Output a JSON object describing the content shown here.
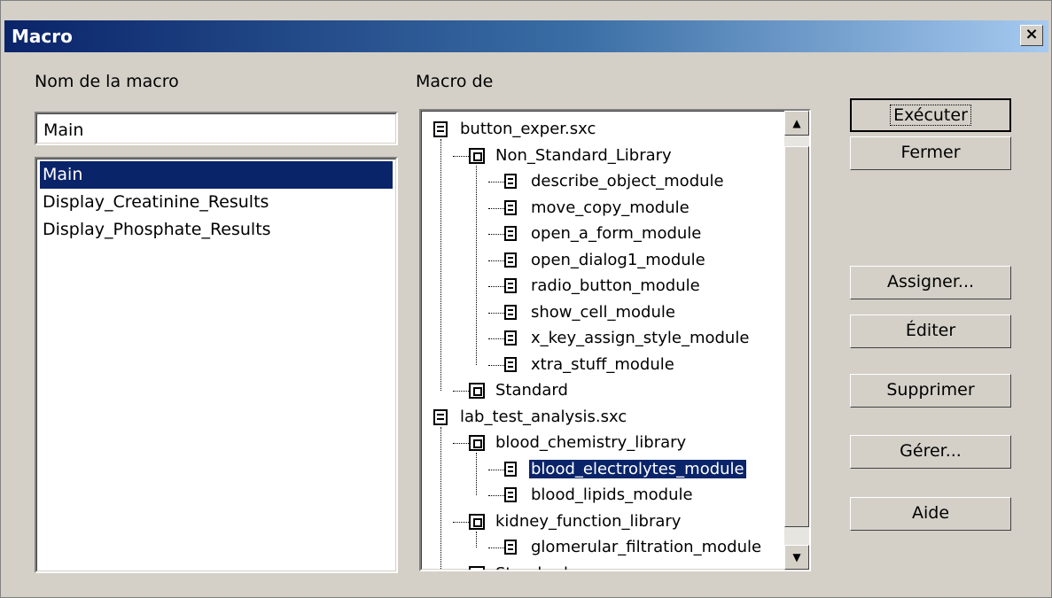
{
  "window": {
    "title": "Macro",
    "close_glyph": "×"
  },
  "left": {
    "name_label": "Nom de la macro",
    "name_value": "Main",
    "macros": [
      {
        "label": "Main",
        "selected": true
      },
      {
        "label": "Display_Creatinine_Results",
        "selected": false
      },
      {
        "label": "Display_Phosphate_Results",
        "selected": false
      }
    ]
  },
  "tree": {
    "label": "Macro de",
    "nodes": [
      {
        "label": "button_exper.sxc",
        "type": "document",
        "level": 0
      },
      {
        "label": "Non_Standard_Library",
        "type": "library",
        "level": 1
      },
      {
        "label": "describe_object_module",
        "type": "module",
        "level": 2
      },
      {
        "label": "move_copy_module",
        "type": "module",
        "level": 2
      },
      {
        "label": "open_a_form_module",
        "type": "module",
        "level": 2
      },
      {
        "label": "open_dialog1_module",
        "type": "module",
        "level": 2
      },
      {
        "label": "radio_button_module",
        "type": "module",
        "level": 2
      },
      {
        "label": "show_cell_module",
        "type": "module",
        "level": 2
      },
      {
        "label": "x_key_assign_style_module",
        "type": "module",
        "level": 2
      },
      {
        "label": "xtra_stuff_module",
        "type": "module",
        "level": 2
      },
      {
        "label": "Standard",
        "type": "library",
        "level": 1
      },
      {
        "label": "lab_test_analysis.sxc",
        "type": "document",
        "level": 0
      },
      {
        "label": "blood_chemistry_library",
        "type": "library",
        "level": 1
      },
      {
        "label": "blood_electrolytes_module",
        "type": "module",
        "level": 2,
        "selected": true
      },
      {
        "label": "blood_lipids_module",
        "type": "module",
        "level": 2
      },
      {
        "label": "kidney_function_library",
        "type": "library",
        "level": 1
      },
      {
        "label": "glomerular_filtration_module",
        "type": "module",
        "level": 2
      },
      {
        "label": "Standard",
        "type": "library",
        "level": 1
      }
    ],
    "scroll_up_glyph": "▲",
    "scroll_down_glyph": "▼"
  },
  "buttons": {
    "run": "Exécuter",
    "close": "Fermer",
    "assign": "Assigner...",
    "edit": "Éditer",
    "delete": "Supprimer",
    "manage": "Gérer...",
    "help": "Aide"
  }
}
